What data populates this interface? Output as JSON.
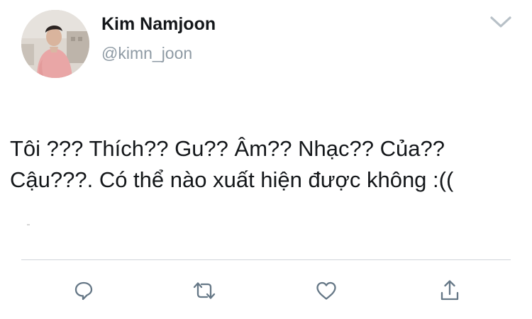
{
  "user": {
    "display_name": "Kim Namjoon",
    "handle": "@kimn_joon",
    "avatar_icon": "profile-photo"
  },
  "menu": {
    "caret_icon": "chevron-down-icon"
  },
  "tweet": {
    "lines": [
      "Tôi ??? Thích?? Gu?? Âm?? Nhạc?? Của??",
      "Cậu???. Có thể nào xuất hiện được không :(("
    ]
  },
  "actions": [
    {
      "name": "reply",
      "icon": "reply-icon"
    },
    {
      "name": "retweet",
      "icon": "retweet-icon"
    },
    {
      "name": "like",
      "icon": "heart-icon"
    },
    {
      "name": "share",
      "icon": "share-icon"
    }
  ],
  "colors": {
    "text": "#14171a",
    "secondary": "#8e9aa4",
    "icon": "#657786",
    "divider": "#d0d5d9"
  }
}
